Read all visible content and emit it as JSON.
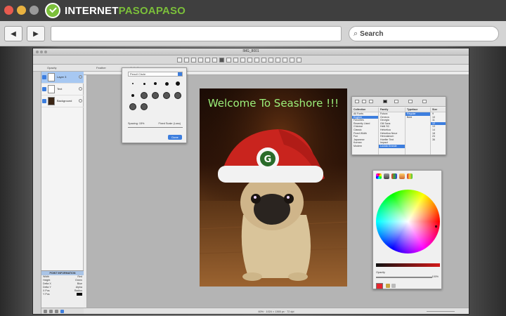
{
  "outer": {
    "brand_prefix": "INTERNET",
    "brand_highlight": "PASOAPASO",
    "search_label": "Search",
    "nav_back_glyph": "◀",
    "nav_forward_glyph": "▶"
  },
  "app": {
    "window_title": "IMG_8001",
    "options": {
      "opacity_label": "Opacity",
      "feather_label": "Feather",
      "antialias_label": "Anti-alias"
    },
    "layers": [
      {
        "name": "Layer 3",
        "selected": true
      },
      {
        "name": "Text",
        "selected": false
      },
      {
        "name": "Background",
        "selected": false
      }
    ],
    "pointer_info": {
      "header": "POINT INFORMATION",
      "rows": [
        {
          "label": "Width",
          "value": "Red"
        },
        {
          "label": "Height",
          "value": "Green"
        },
        {
          "label": "Delta X",
          "value": "Blue"
        },
        {
          "label": "Delta Y",
          "value": "Alpha"
        },
        {
          "label": "X Pos",
          "value": "Radius"
        },
        {
          "label": "Y Pos",
          "value": ""
        }
      ]
    },
    "status_text": "60% · 1024 × 1365 px · 72 dpi",
    "image_caption": "Welcome To Seashore !!!",
    "brushes": {
      "selector": "Pencil Circle",
      "spacing_label": "Spacing: 15%",
      "fixed_label": "Fixed Scale (Loss)",
      "ok_label": "Done"
    },
    "fonts": {
      "collection_header": "Collection",
      "collections": [
        "All Fonts",
        "English",
        "Favorites",
        "Recently Used",
        "Chinese",
        "Classic",
        "Fixed Width",
        "Fun",
        "Japanese",
        "Korean",
        "Modern"
      ],
      "family_header": "Family",
      "families": [
        "Futura",
        "Geneva",
        "Georgia",
        "Gill Sans",
        "Heiti SC",
        "Helvetica",
        "Helvetica Neue",
        "Herculanum",
        "Hoefler Text",
        "Impact",
        "Lucida Grande"
      ],
      "typeface_header": "Typeface",
      "typefaces": [
        "Regular",
        "Bold"
      ],
      "size_header": "Size",
      "sizes": [
        "9",
        "10",
        "11",
        "12",
        "13",
        "14",
        "18",
        "24",
        "36"
      ]
    },
    "colors": {
      "opacity_label": "Opacity",
      "opacity_value": "100%",
      "current_color": "#e7252e"
    }
  }
}
